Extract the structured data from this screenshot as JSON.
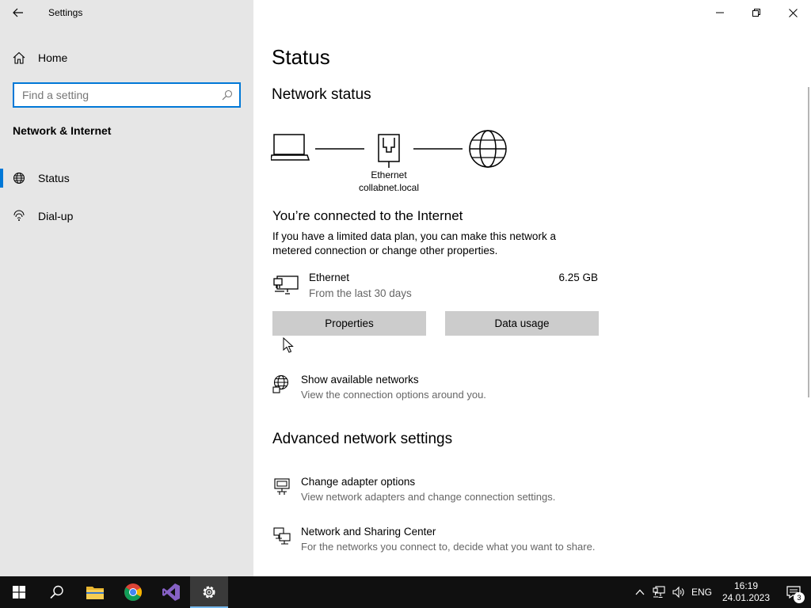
{
  "window": {
    "title": "Settings"
  },
  "sidebar": {
    "home_label": "Home",
    "search_placeholder": "Find a setting",
    "section_title": "Network & Internet",
    "items": [
      {
        "label": "Status",
        "icon": "globe-icon",
        "active": true
      },
      {
        "label": "Dial-up",
        "icon": "dialup-icon",
        "active": false
      }
    ]
  },
  "main": {
    "title": "Status",
    "network_status_heading": "Network status",
    "diagram": {
      "adapter_name": "Ethernet",
      "domain": "collabnet.local"
    },
    "connected_text": "You’re connected to the Internet",
    "description": "If you have a limited data plan, you can make this network a metered connection or change other properties.",
    "connection": {
      "name": "Ethernet",
      "period": "From the last 30 days",
      "usage": "6.25 GB"
    },
    "buttons": {
      "properties": "Properties",
      "data_usage": "Data usage"
    },
    "show_networks": {
      "title": "Show available networks",
      "subtitle": "View the connection options around you."
    },
    "advanced_heading": "Advanced network settings",
    "advanced": [
      {
        "title": "Change adapter options",
        "subtitle": "View network adapters and change connection settings."
      },
      {
        "title": "Network and Sharing Center",
        "subtitle": "For the networks you connect to, decide what you want to share."
      }
    ]
  },
  "taskbar": {
    "language": "ENG",
    "time": "16:19",
    "date": "24.01.2023",
    "notification_count": "3"
  },
  "colors": {
    "accent": "#0078d7",
    "sidebar_bg": "#e6e6e6",
    "button_bg": "#cccccc",
    "taskbar_bg": "#101010"
  }
}
